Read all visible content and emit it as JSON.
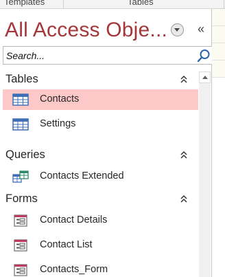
{
  "ribbon": {
    "groups": [
      "Templates",
      "Tables"
    ]
  },
  "nav_pane": {
    "title": "All Access Obje...",
    "search": {
      "placeholder": "Search...",
      "value": ""
    },
    "groups": [
      {
        "label": "Tables",
        "items": [
          {
            "label": "Contacts",
            "icon": "table-icon",
            "selected": true
          },
          {
            "label": "Settings",
            "icon": "table-icon",
            "selected": false
          }
        ]
      },
      {
        "label": "Queries",
        "items": [
          {
            "label": "Contacts Extended",
            "icon": "query-icon",
            "selected": false
          }
        ]
      },
      {
        "label": "Forms",
        "items": [
          {
            "label": "Contact Details",
            "icon": "form-icon",
            "selected": false
          },
          {
            "label": "Contact List",
            "icon": "form-icon",
            "selected": false
          },
          {
            "label": "Contacts_Form",
            "icon": "form-icon",
            "selected": false
          }
        ]
      }
    ]
  },
  "colors": {
    "title": "#a4373a",
    "selected_row": "#fcc8c8",
    "form_icon_accent": "#c0395e",
    "table_icon_accent": "#3f6fb5"
  }
}
